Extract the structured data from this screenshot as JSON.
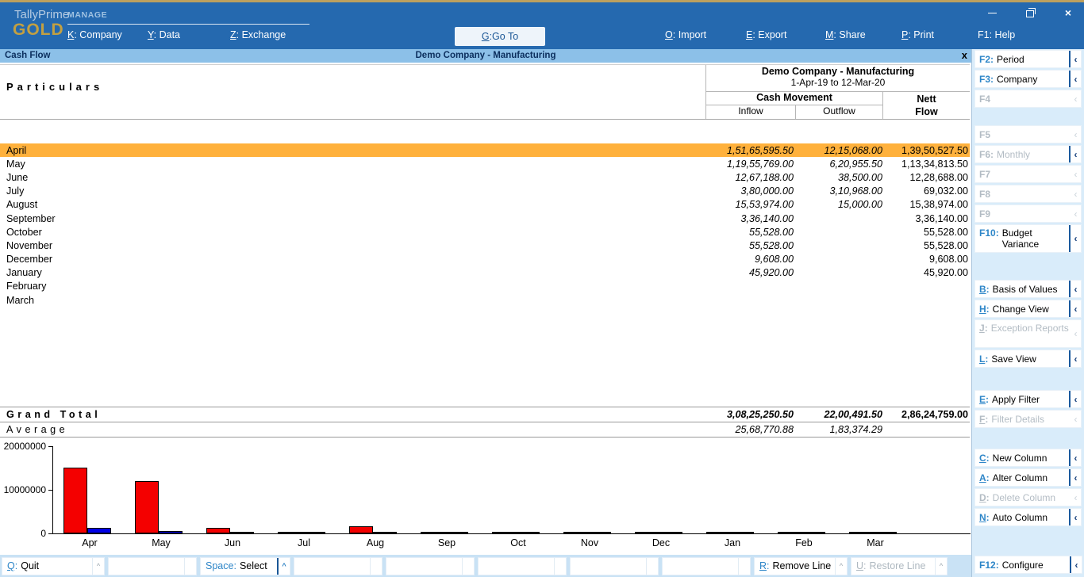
{
  "topbar": {
    "product": "TallyPrime",
    "edition": "GOLD",
    "section": "MANAGE",
    "menu": [
      {
        "key": "K",
        "label": "Company",
        "ul": true
      },
      {
        "key": "Y",
        "label": "Data",
        "ul": true
      },
      {
        "key": "Z",
        "label": "Exchange",
        "ul": true
      }
    ],
    "goto": {
      "key": "G",
      "label": "Go To"
    },
    "right_menu": [
      {
        "key": "O",
        "label": "Import",
        "ul": true
      },
      {
        "key": "E",
        "label": "Export",
        "ul": true
      },
      {
        "key": "M",
        "label": "Share",
        "ul": true
      },
      {
        "key": "P",
        "label": "Print",
        "ul": true
      },
      {
        "key": "F1",
        "label": "Help",
        "ul": false
      }
    ],
    "window_controls": {
      "minimize": "minimize",
      "restore": "restore",
      "close": "×"
    }
  },
  "titlebar": {
    "report": "Cash Flow",
    "company": "Demo Company - Manufacturing",
    "close": "x"
  },
  "header": {
    "particulars": "Particulars",
    "company": "Demo Company - Manufacturing",
    "period": "1-Apr-19 to 12-Mar-20",
    "cash_movement": "Cash Movement",
    "inflow": "Inflow",
    "outflow": "Outflow",
    "nett1": "Nett",
    "nett2": "Flow"
  },
  "rows": [
    {
      "month": "April",
      "inflow": "1,51,65,595.50",
      "outflow": "12,15,068.00",
      "nett": "1,39,50,527.50",
      "highlighted": true
    },
    {
      "month": "May",
      "inflow": "1,19,55,769.00",
      "outflow": "6,20,955.50",
      "nett": "1,13,34,813.50",
      "highlighted": false
    },
    {
      "month": "June",
      "inflow": "12,67,188.00",
      "outflow": "38,500.00",
      "nett": "12,28,688.00",
      "highlighted": false
    },
    {
      "month": "July",
      "inflow": "3,80,000.00",
      "outflow": "3,10,968.00",
      "nett": "69,032.00",
      "highlighted": false
    },
    {
      "month": "August",
      "inflow": "15,53,974.00",
      "outflow": "15,000.00",
      "nett": "15,38,974.00",
      "highlighted": false
    },
    {
      "month": "September",
      "inflow": "3,36,140.00",
      "outflow": "",
      "nett": "3,36,140.00",
      "highlighted": false
    },
    {
      "month": "October",
      "inflow": "55,528.00",
      "outflow": "",
      "nett": "55,528.00",
      "highlighted": false
    },
    {
      "month": "November",
      "inflow": "55,528.00",
      "outflow": "",
      "nett": "55,528.00",
      "highlighted": false
    },
    {
      "month": "December",
      "inflow": "9,608.00",
      "outflow": "",
      "nett": "9,608.00",
      "highlighted": false
    },
    {
      "month": "January",
      "inflow": "45,920.00",
      "outflow": "",
      "nett": "45,920.00",
      "highlighted": false
    },
    {
      "month": "February",
      "inflow": "",
      "outflow": "",
      "nett": "",
      "highlighted": false
    },
    {
      "month": "March",
      "inflow": "",
      "outflow": "",
      "nett": "",
      "highlighted": false
    }
  ],
  "totals": {
    "grand_label": "Grand Total",
    "grand_inflow": "3,08,25,250.50",
    "grand_outflow": "22,00,491.50",
    "grand_nett": "2,86,24,759.00",
    "avg_label": "Average",
    "avg_inflow": "25,68,770.88",
    "avg_outflow": "1,83,374.29",
    "avg_nett": ""
  },
  "chart_data": {
    "type": "bar",
    "title": "",
    "categories": [
      "Apr",
      "May",
      "Jun",
      "Jul",
      "Aug",
      "Sep",
      "Oct",
      "Nov",
      "Dec",
      "Jan",
      "Feb",
      "Mar"
    ],
    "series": [
      {
        "name": "Inflow",
        "color": "#f40000",
        "values": [
          15165595.5,
          11955769,
          1267188,
          380000,
          1553974,
          336140,
          55528,
          55528,
          9608,
          45920,
          0,
          0
        ]
      },
      {
        "name": "Outflow",
        "color": "#0000e6",
        "values": [
          1215068,
          620955.5,
          38500,
          310968,
          15000,
          0,
          0,
          0,
          0,
          0,
          0,
          0
        ]
      }
    ],
    "ylim": [
      0,
      20000000
    ],
    "yticks": [
      0,
      10000000,
      20000000
    ],
    "grid": false,
    "legend": "none"
  },
  "sidebar": {
    "buttons": [
      {
        "name": "period",
        "key": "F2",
        "label": "Period",
        "enabled": true,
        "ul": false,
        "chev": true
      },
      {
        "name": "company",
        "key": "F3",
        "label": "Company",
        "enabled": true,
        "ul": false,
        "chev": true
      },
      {
        "name": "f4",
        "key": "F4",
        "label": "",
        "enabled": false,
        "ul": false,
        "chev": false
      },
      {
        "gap": 20
      },
      {
        "name": "f5",
        "key": "F5",
        "label": "",
        "enabled": false,
        "ul": false,
        "chev": false
      },
      {
        "name": "monthly",
        "key": "F6",
        "label": "Monthly",
        "enabled": false,
        "ul": false,
        "chev": true
      },
      {
        "name": "f7",
        "key": "F7",
        "label": "",
        "enabled": false,
        "ul": false,
        "chev": false
      },
      {
        "name": "f8",
        "key": "F8",
        "label": "",
        "enabled": false,
        "ul": false,
        "chev": false
      },
      {
        "name": "f9",
        "key": "F9",
        "label": "",
        "enabled": false,
        "ul": false,
        "chev": false
      },
      {
        "name": "budget-variance",
        "key": "F10",
        "label": "Budget Variance",
        "enabled": true,
        "ul": false,
        "chev": true,
        "two": true
      },
      {
        "gap": 32
      },
      {
        "name": "basis-of-values",
        "key": "B",
        "label": "Basis of Values",
        "enabled": true,
        "ul": true,
        "chev": true
      },
      {
        "name": "change-view",
        "key": "H",
        "label": "Change View",
        "enabled": true,
        "ul": true,
        "chev": true
      },
      {
        "name": "exception-reports",
        "key": "J",
        "label": "Exception Reports",
        "enabled": false,
        "ul": true,
        "chev": false,
        "two": true
      },
      {
        "name": "save-view",
        "key": "L",
        "label": "Save View",
        "enabled": true,
        "ul": true,
        "chev": true
      },
      {
        "gap": 26
      },
      {
        "name": "apply-filter",
        "key": "E",
        "label": "Apply Filter",
        "enabled": true,
        "ul": true,
        "chev": true
      },
      {
        "name": "filter-details",
        "key": "F",
        "label": "Filter Details",
        "enabled": false,
        "ul": true,
        "chev": false
      },
      {
        "gap": 24
      },
      {
        "name": "new-column",
        "key": "C",
        "label": "New Column",
        "enabled": true,
        "ul": true,
        "chev": true
      },
      {
        "name": "alter-column",
        "key": "A",
        "label": "Alter Column",
        "enabled": true,
        "ul": true,
        "chev": true
      },
      {
        "name": "delete-column",
        "key": "D",
        "label": "Delete Column",
        "enabled": false,
        "ul": true,
        "chev": false
      },
      {
        "name": "auto-column",
        "key": "N",
        "label": "Auto Column",
        "enabled": true,
        "ul": true,
        "chev": true
      }
    ],
    "configure": {
      "name": "configure",
      "key": "F12",
      "label": "Configure",
      "enabled": true,
      "ul": false,
      "chev": true
    }
  },
  "bottombar": {
    "buttons": [
      {
        "name": "quit",
        "key": "Q",
        "label": "Quit",
        "enabled": true,
        "ul": true,
        "caret": "dim"
      },
      {
        "name": "empty-1",
        "empty": true
      },
      {
        "name": "select",
        "key": "Space",
        "label": "Select",
        "enabled": true,
        "ul": false,
        "caret": "on"
      },
      {
        "name": "empty-2",
        "empty": true
      },
      {
        "name": "empty-3",
        "empty": true
      },
      {
        "name": "empty-4",
        "empty": true
      },
      {
        "name": "empty-5",
        "empty": true
      },
      {
        "name": "empty-6",
        "empty": true
      },
      {
        "name": "remove-line",
        "key": "R",
        "label": "Remove Line",
        "enabled": true,
        "ul": true,
        "caret": "dim"
      },
      {
        "name": "restore-line",
        "key": "U",
        "label": "Restore Line",
        "enabled": false,
        "ul": true,
        "caret": "dim"
      }
    ]
  },
  "colors": {
    "topbar": "#2569af",
    "gold_accent": "#bda05e",
    "title_strip": "#8cc0e8",
    "sidebar_bg": "#d9ecfa",
    "bottombar_bg": "#c9e2f5",
    "highlight_row": "#ffb13c",
    "inflow_bar": "#f40000",
    "outflow_bar": "#0000e6",
    "shortcut_key": "#2e86c8"
  }
}
